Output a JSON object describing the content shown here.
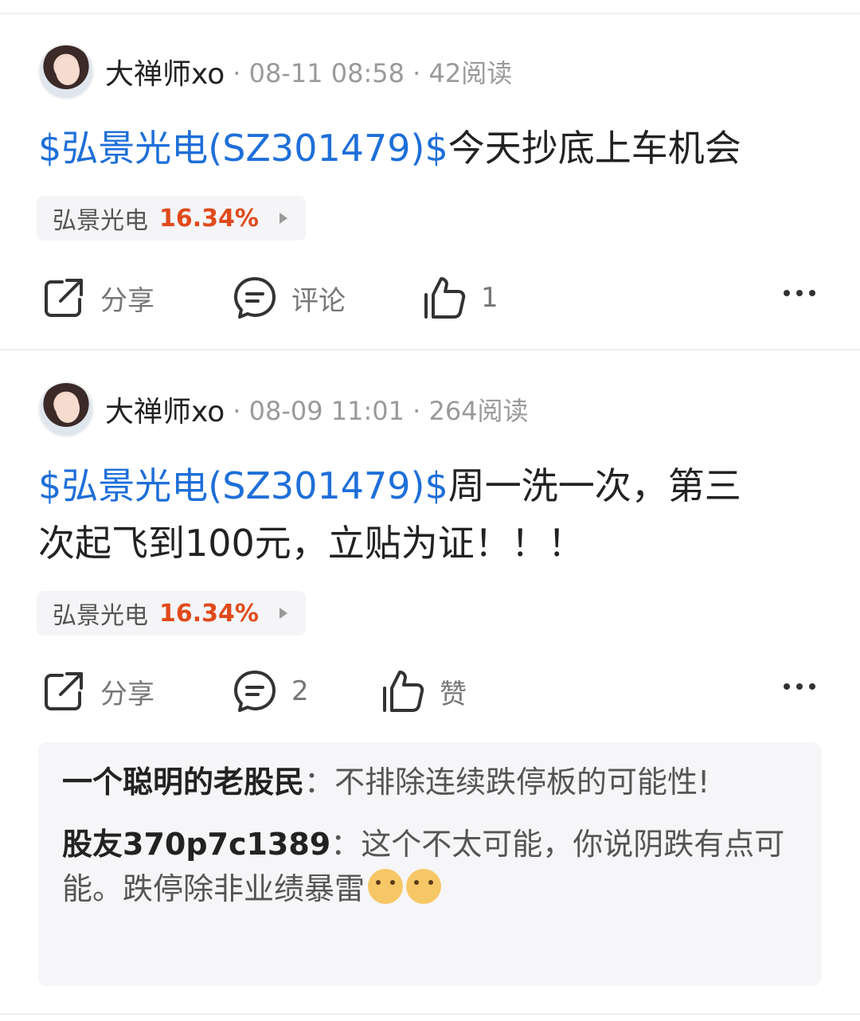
{
  "posts": [
    {
      "author": "大禅师xo",
      "meta": "· 08-11 08:58 · 42阅读",
      "stock_link": "$弘景光电(SZ301479)$",
      "text": "今天抄底上车机会",
      "stock_tag": {
        "name": "弘景光电",
        "change": "16.34%"
      },
      "actions": {
        "share": "分享",
        "comment": "评论",
        "like": "1"
      }
    },
    {
      "author": "大禅师xo",
      "meta": "· 08-09 11:01 · 264阅读",
      "stock_link": "$弘景光电(SZ301479)$",
      "text_line1": "周一洗一次，第三",
      "text_line2": "次起飞到100元，立贴为证！！！",
      "stock_tag": {
        "name": "弘景光电",
        "change": "16.34%"
      },
      "actions": {
        "share": "分享",
        "comment": "2",
        "like": "赞"
      },
      "comments": [
        {
          "author": "一个聪明的老股民",
          "sep": "：",
          "text": "不排除连续跌停板的可能性!"
        },
        {
          "author": "股友370p7c1389",
          "sep": "：",
          "text": "这个不太可能，你说阴跌有点可能。跌停除非业绩暴雷"
        }
      ]
    }
  ],
  "colors": {
    "link": "#1e6fd9",
    "up": "#e04a1b"
  },
  "icons": [
    "share-icon",
    "comment-icon",
    "like-icon",
    "more-icon",
    "dog-emoji-icon"
  ]
}
